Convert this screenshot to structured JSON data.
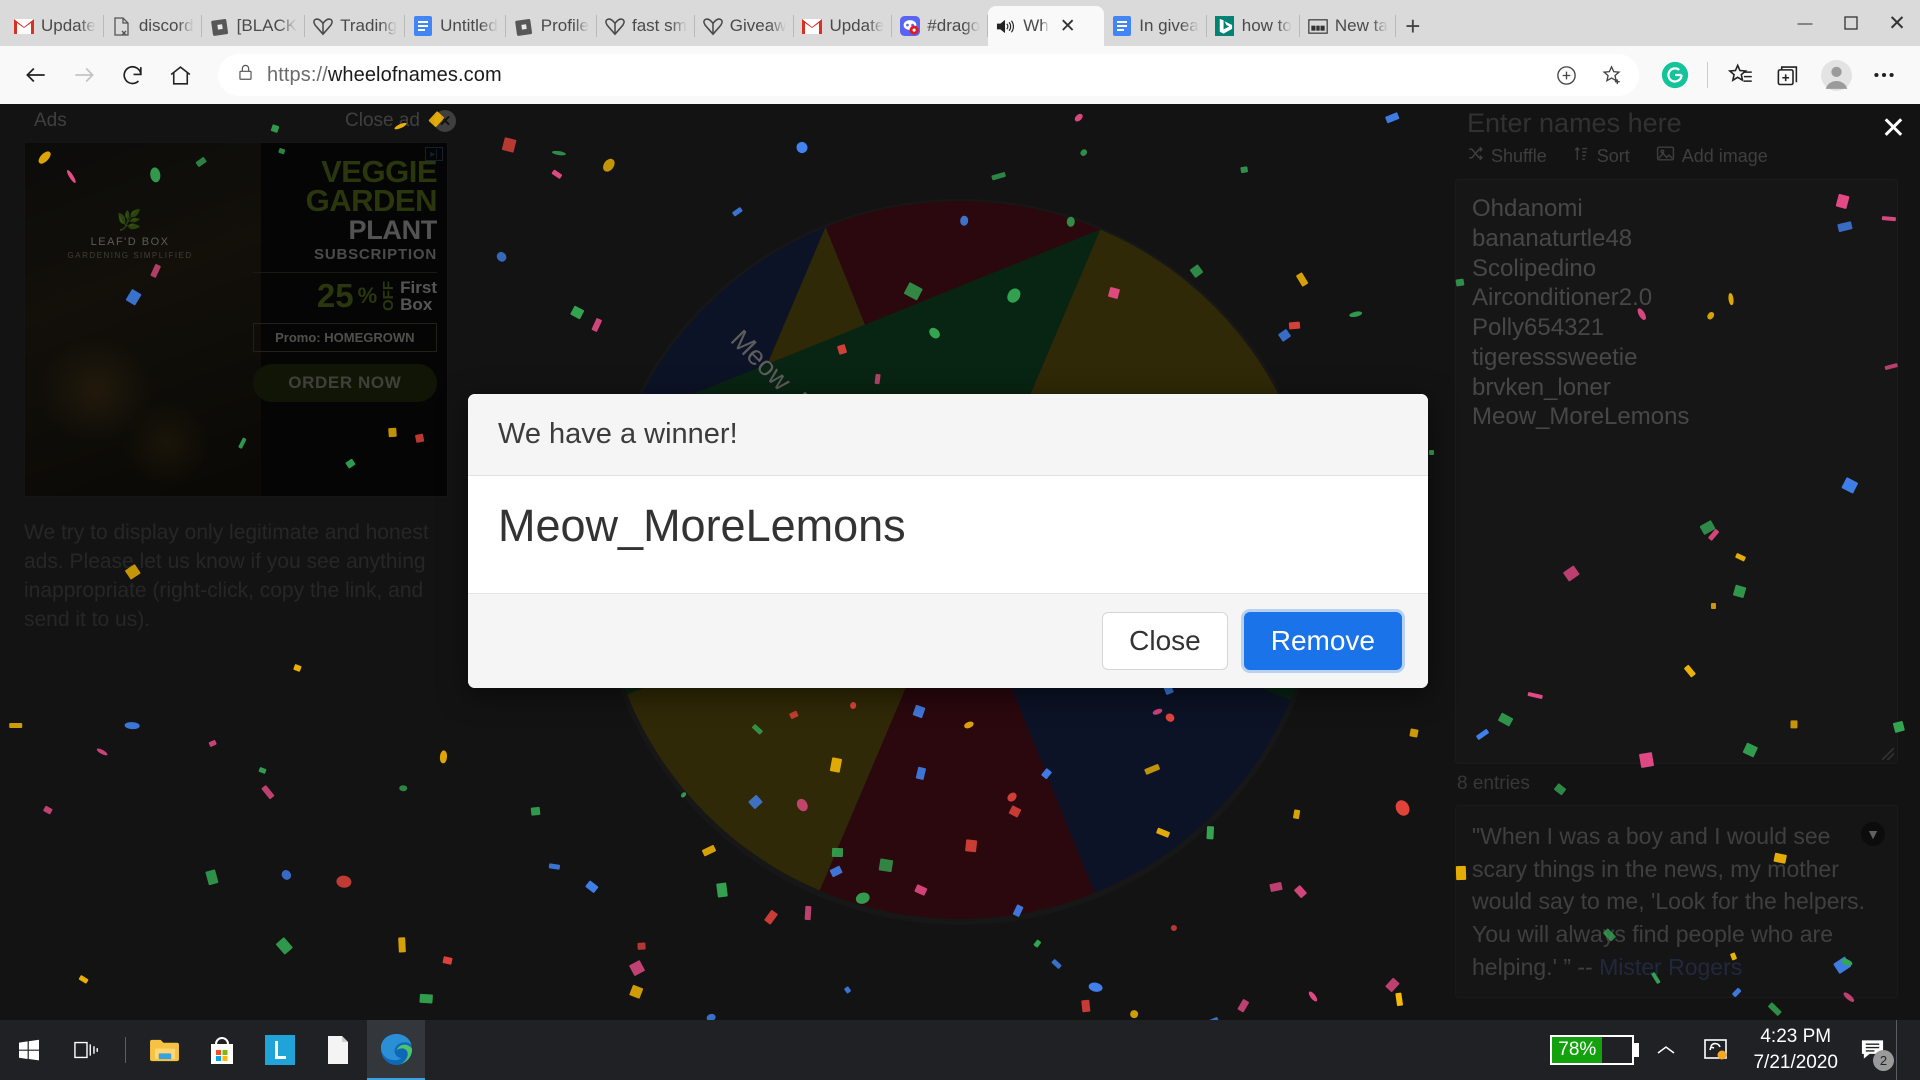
{
  "browser": {
    "tabs": [
      {
        "label": "Update",
        "icon": "gmail-icon"
      },
      {
        "label": "discord",
        "icon": "broken-page-icon"
      },
      {
        "label": "[BLACK",
        "icon": "roblox-icon"
      },
      {
        "label": "Trading",
        "icon": "shopify-icon"
      },
      {
        "label": "Untitled",
        "icon": "google-docs-icon"
      },
      {
        "label": "Profile",
        "icon": "roblox-icon"
      },
      {
        "label": "fast sm",
        "icon": "shopify-icon"
      },
      {
        "label": "Giveaw",
        "icon": "shopify-icon"
      },
      {
        "label": "Update",
        "icon": "gmail-icon"
      },
      {
        "label": "#drago",
        "icon": "discord-icon"
      },
      {
        "label": "Wh",
        "icon": "speaker-playing-icon",
        "active": true
      },
      {
        "label": "In givea",
        "icon": "google-docs-icon"
      },
      {
        "label": "how to",
        "icon": "bing-icon"
      },
      {
        "label": "New ta",
        "icon": "newtab-icon"
      }
    ],
    "new_tab_label": "+",
    "window_controls": {
      "minimize": "—",
      "maximize": "☐",
      "close": "✕"
    },
    "nav": {
      "back": "back-arrow",
      "forward": "forward-arrow",
      "refresh": "refresh",
      "home": "home",
      "url": "https://wheelofnames.com",
      "url_scheme": "https://",
      "url_host": "wheelofnames.com",
      "lock": "lock-icon",
      "add_to_collection": "plus-circle-icon",
      "favorite": "star-plus-icon",
      "grammarly": "grammarly-icon",
      "favorites_list": "favorites-icon",
      "collections": "collections-icon",
      "profile": "profile-avatar",
      "settings": "ellipsis-icon"
    }
  },
  "ads": {
    "label": "Ads",
    "close_label": "Close ad",
    "creative": {
      "brand": "LEAF'D BOX",
      "brand_sub": "GARDENING SIMPLIFIED",
      "line1": "VEGGIE",
      "line2": "GARDEN",
      "line3": "PLANT",
      "line4": "SUBSCRIPTION",
      "discount": "25",
      "percent": "%",
      "off": "OFF",
      "first": "First",
      "box": "Box",
      "promo": "Promo: HOMEGROWN",
      "cta": "ORDER NOW"
    },
    "disclaimer": "We try to display only legitimate and honest ads. Please let us know if you see anything inappropriate (right-click, copy the link, and send it to us)."
  },
  "wheel": {
    "segments": [
      {
        "name": "Ohdanomi",
        "color": "#1b2a55"
      },
      {
        "name": "bananaturtle48",
        "color": "#5e1220"
      },
      {
        "name": "Scolipedino",
        "color": "#6b5c10"
      },
      {
        "name": "Airconditioner2.0",
        "color": "#12502a"
      },
      {
        "name": "Polly654321",
        "color": "#1b2a55"
      },
      {
        "name": "tigeresssweetie",
        "color": "#5e1220"
      },
      {
        "name": "brvken_loner",
        "color": "#6b5c10"
      },
      {
        "name": "Meow_MoreLemons",
        "color": "#12502a"
      }
    ]
  },
  "names_panel": {
    "placeholder": "Enter names here",
    "tools": [
      {
        "label": "Shuffle",
        "icon": "shuffle-icon"
      },
      {
        "label": "Sort",
        "icon": "sort-icon"
      },
      {
        "label": "Add image",
        "icon": "image-icon"
      }
    ],
    "names": [
      "Ohdanomi",
      "bananaturtle48",
      "Scolipedino",
      "Airconditioner2.0",
      "Polly654321",
      "tigeresssweetie",
      "brvken_loner",
      "Meow_MoreLemons"
    ],
    "entries": "8 entries",
    "close_icon": "close-icon",
    "quote": {
      "text": "\"When I was a boy and I would see scary things in the news, my mother would say to me, 'Look for the helpers. You will always find people who are helping.' ” -- ",
      "author": "Mister Rogers",
      "dropdown_icon": "chevron-down-circle-icon"
    }
  },
  "winner_dialog": {
    "title": "We have a winner!",
    "winner": "Meow_MoreLemons",
    "close_label": "Close",
    "remove_label": "Remove"
  },
  "taskbar": {
    "start": "windows-start-icon",
    "task_view": "task-view-icon",
    "apps": [
      {
        "name": "file-explorer-icon"
      },
      {
        "name": "microsoft-store-icon"
      },
      {
        "name": "app-l-icon"
      },
      {
        "name": "document-icon"
      },
      {
        "name": "microsoft-edge-icon",
        "active": true
      }
    ],
    "tray": {
      "battery_percent": "78%",
      "chevron": "show-hidden-icons",
      "onedrive": "onedrive-sync-icon",
      "time": "4:23 PM",
      "date": "7/21/2020",
      "notifications": "2"
    }
  },
  "colors": {
    "accent_blue": "#1a73e8",
    "battery_green": "#13a10e",
    "page_bg": "#2b2b2b"
  }
}
